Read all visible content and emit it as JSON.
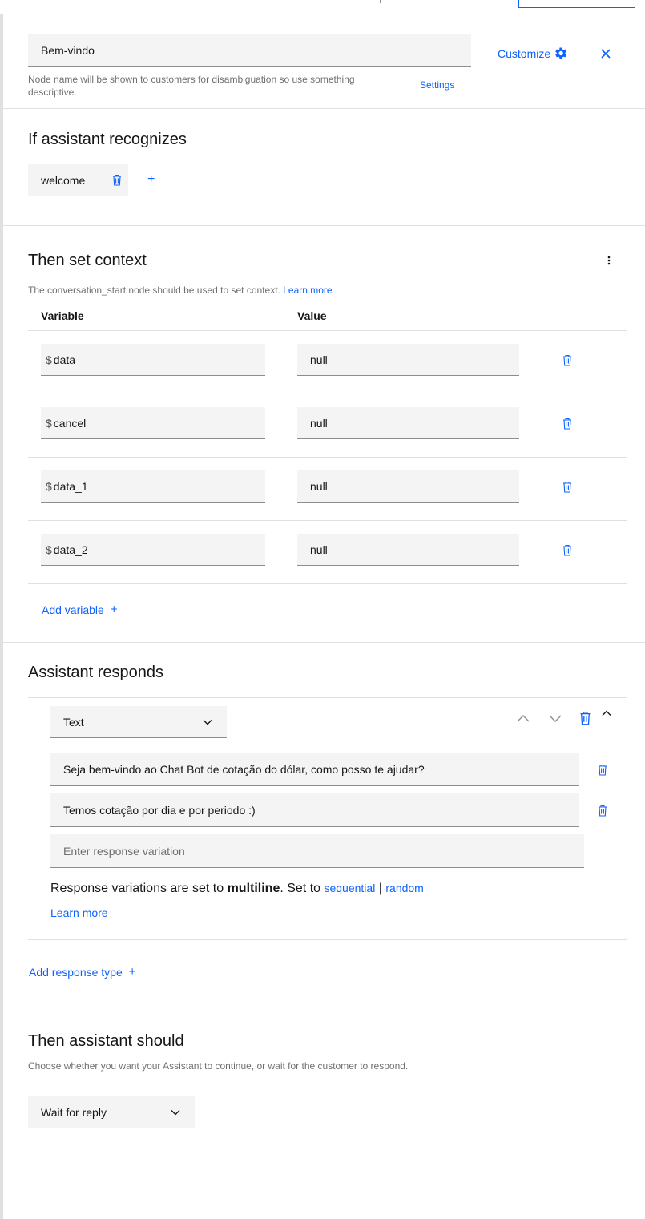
{
  "header": {
    "node_name_value": "Bem-vindo",
    "node_name_helper": "Node name will be shown to customers for disambiguation so use something descriptive.",
    "settings_label": "Settings",
    "customize_label": "Customize"
  },
  "recognizes": {
    "title": "If assistant recognizes",
    "condition_value": "welcome",
    "add_symbol": "+"
  },
  "context": {
    "title": "Then set context",
    "helper": "The conversation_start node should be used to set context.",
    "learn_more": "Learn more",
    "col_variable": "Variable",
    "col_value": "Value",
    "dollar": "$",
    "rows": [
      {
        "variable": "data",
        "value": "null"
      },
      {
        "variable": "cancel",
        "value": "null"
      },
      {
        "variable": "data_1",
        "value": "null"
      },
      {
        "variable": "data_2",
        "value": "null"
      }
    ],
    "add_variable": "Add variable"
  },
  "responds": {
    "title": "Assistant responds",
    "response_type": "Text",
    "variations": [
      "Seja bem-vindo ao Chat Bot de cotação do dólar, como posso te ajudar?",
      "Temos cotação por dia e por periodo :)"
    ],
    "new_variation_placeholder": "Enter response variation",
    "note_prefix": "Response variations are set to ",
    "note_mode": "multiline",
    "note_middle": ". Set to ",
    "note_sequential": "sequential",
    "note_sep": "|",
    "note_random": "random",
    "learn_more": "Learn more",
    "add_response_type": "Add response type"
  },
  "then_should": {
    "title": "Then assistant should",
    "helper": "Choose whether you want your Assistant to continue, or wait for the customer to respond.",
    "selected": "Wait for reply"
  },
  "colors": {
    "accent": "#0f62fe",
    "field_bg": "#f4f4f4",
    "border": "#e0e0e0"
  }
}
